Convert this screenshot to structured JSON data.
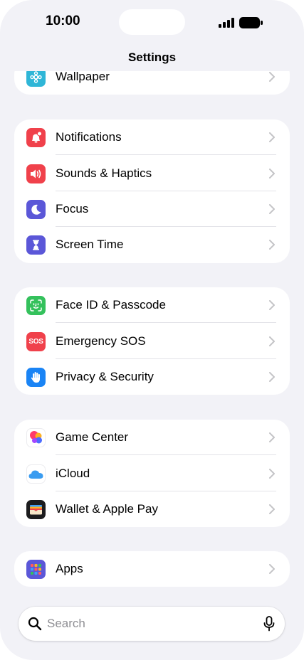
{
  "status_bar": {
    "time": "10:00"
  },
  "nav": {
    "title": "Settings"
  },
  "groups": [
    {
      "items": [
        {
          "label": "Wallpaper",
          "icon": "wallpaper-icon",
          "color": "#2fb6d7"
        }
      ]
    },
    {
      "items": [
        {
          "label": "Notifications",
          "icon": "notifications-icon",
          "color": "#f0414b"
        },
        {
          "label": "Sounds & Haptics",
          "icon": "speaker-icon",
          "color": "#f0414b"
        },
        {
          "label": "Focus",
          "icon": "moon-icon",
          "color": "#5b57d8"
        },
        {
          "label": "Screen Time",
          "icon": "hourglass-icon",
          "color": "#5b57d8"
        }
      ]
    },
    {
      "items": [
        {
          "label": "Face ID & Passcode",
          "icon": "face-id-icon",
          "color": "#34c15c"
        },
        {
          "label": "Emergency SOS",
          "icon": "sos-icon",
          "color": "#f0414b",
          "icon_text": "SOS"
        },
        {
          "label": "Privacy & Security",
          "icon": "hand-icon",
          "color": "#1a84f5"
        }
      ]
    },
    {
      "items": [
        {
          "label": "Game Center",
          "icon": "game-center-icon",
          "color": "#ffffff"
        },
        {
          "label": "iCloud",
          "icon": "icloud-icon",
          "color": "#ffffff"
        },
        {
          "label": "Wallet & Apple Pay",
          "icon": "wallet-icon",
          "color": "#1c1c1e"
        }
      ]
    },
    {
      "items": [
        {
          "label": "Apps",
          "icon": "apps-icon",
          "color": "#5b57d8"
        }
      ]
    }
  ],
  "search": {
    "placeholder": "Search"
  }
}
